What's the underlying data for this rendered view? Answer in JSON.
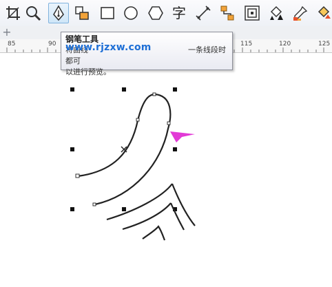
{
  "toolbar": {
    "tools": [
      {
        "icon": "crop-tool-icon",
        "active": false
      },
      {
        "icon": "zoom-tool-icon",
        "active": false
      },
      {
        "icon": "pen-tool-icon",
        "active": true
      },
      {
        "icon": "smart-fill-icon",
        "active": false
      },
      {
        "icon": "rectangle-tool-icon",
        "active": false
      },
      {
        "icon": "ellipse-tool-icon",
        "active": false
      },
      {
        "icon": "polygon-tool-icon",
        "active": false
      },
      {
        "icon": "text-tool-icon",
        "active": false,
        "glyph": "字"
      },
      {
        "icon": "dimension-tool-icon",
        "active": false
      },
      {
        "icon": "connector-tool-icon",
        "active": false
      },
      {
        "icon": "contour-tool-icon",
        "active": false
      },
      {
        "icon": "fill-tool-icon",
        "active": false
      },
      {
        "icon": "eyedropper-tool-icon",
        "active": false
      },
      {
        "icon": "interactive-fill-icon",
        "active": false
      }
    ]
  },
  "dock": {
    "add_label": "+"
  },
  "ruler": {
    "ticks": [
      "85",
      "90",
      "115",
      "120",
      "125"
    ]
  },
  "tooltip": {
    "title": "钢笔工具",
    "line1_start": "将曲线",
    "line1_end": "一条线段时都可",
    "line2": "以进行预览。"
  },
  "watermark": "www.rjzxw.com",
  "colors": {
    "active_tool_bg": "#cfe6f8",
    "annotation_arrow": "#e23ad6",
    "watermark": "#1e6fd6",
    "curve": "#222222"
  }
}
